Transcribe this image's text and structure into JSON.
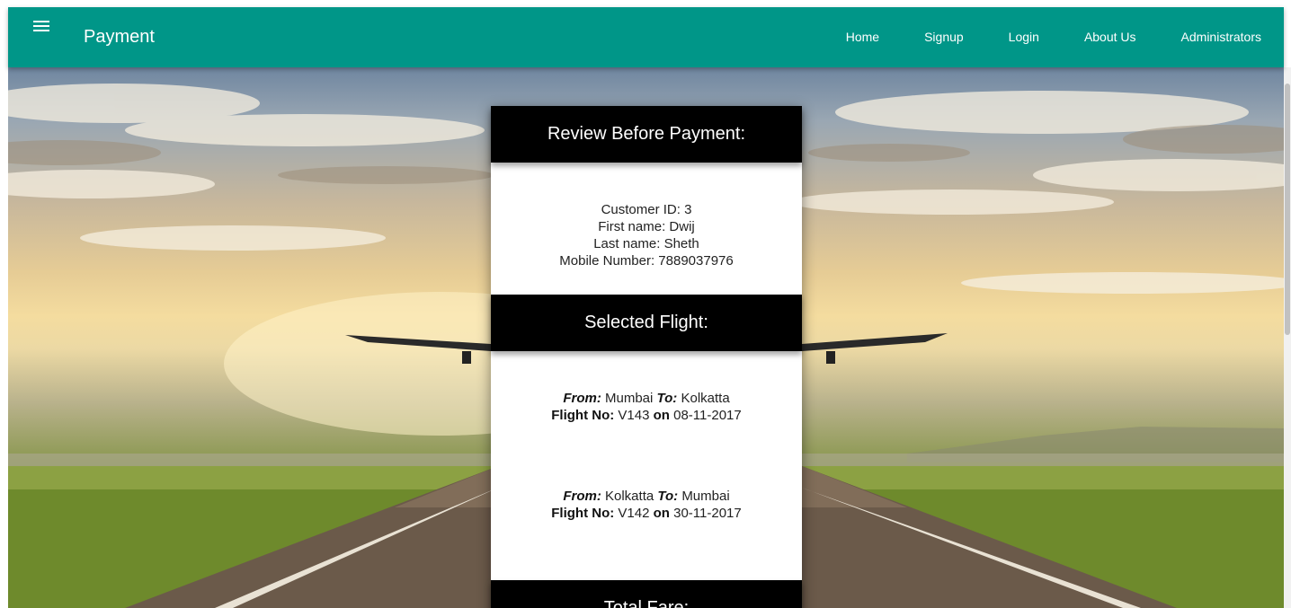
{
  "navbar": {
    "brand": "Payment",
    "links": [
      "Home",
      "Signup",
      "Login",
      "About Us",
      "Administrators"
    ],
    "color": "#009688"
  },
  "review": {
    "header": "Review Before Payment:",
    "customer_id": "Customer ID: 3",
    "first_name": "First name: Dwij",
    "last_name": "Last name: Sheth",
    "mobile": "Mobile Number: 7889037976"
  },
  "selected_flight": {
    "header": "Selected Flight:",
    "labels": {
      "from": "From:",
      "to": "To:",
      "flight_no": "Flight No:",
      "on": "on"
    },
    "flights": [
      {
        "from": "Mumbai",
        "to": "Kolkatta",
        "flight_no": "V143",
        "date": "08-11-2017"
      },
      {
        "from": "Kolkatta",
        "to": "Mumbai",
        "flight_no": "V142",
        "date": "30-11-2017"
      }
    ]
  },
  "total_fare": {
    "header": "Total Fare:"
  }
}
